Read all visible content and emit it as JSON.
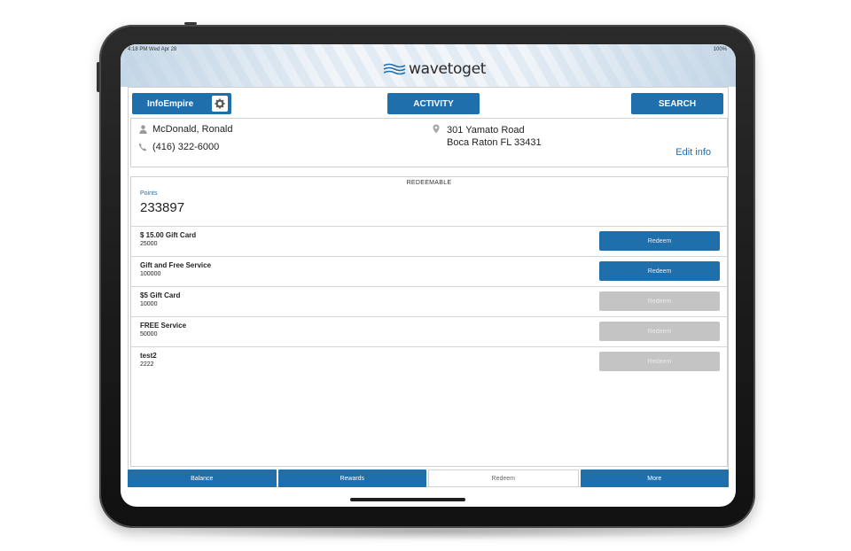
{
  "status_bar": {
    "time": "4:18 PM  Wed Apr 28",
    "battery": "100%"
  },
  "brand": {
    "name": "wavetoget",
    "accent": "#1f6fad"
  },
  "toolbar": {
    "account_label": "InfoEmpire",
    "account_icon": "gear-icon",
    "activity_label": "ACTIVITY",
    "search_label": "SEARCH"
  },
  "customer": {
    "name": "McDonald, Ronald",
    "phone": "(416) 322-6000",
    "address_line1": "301 Yamato Road",
    "address_line2": "Boca Raton FL 33431",
    "edit_label": "Edit info"
  },
  "redeem_panel": {
    "title": "REDEEMABLE",
    "points_label": "Points",
    "points_value": "233897",
    "rewards": [
      {
        "name": "$ 15.00 Gift Card",
        "cost": "25000",
        "button": "Redeem",
        "enabled": true
      },
      {
        "name": "Gift and Free Service",
        "cost": "100000",
        "button": "Redeem",
        "enabled": true
      },
      {
        "name": "$5 Gift Card",
        "cost": "10000",
        "button": "Redeem",
        "enabled": false
      },
      {
        "name": "FREE Service",
        "cost": "50000",
        "button": "Redeem",
        "enabled": false
      },
      {
        "name": "test2",
        "cost": "2222",
        "button": "Redeem",
        "enabled": false
      }
    ]
  },
  "tabs": [
    {
      "label": "Balance",
      "selected": false
    },
    {
      "label": "Rewards",
      "selected": false
    },
    {
      "label": "Redeem",
      "selected": true
    },
    {
      "label": "More",
      "selected": false
    }
  ]
}
